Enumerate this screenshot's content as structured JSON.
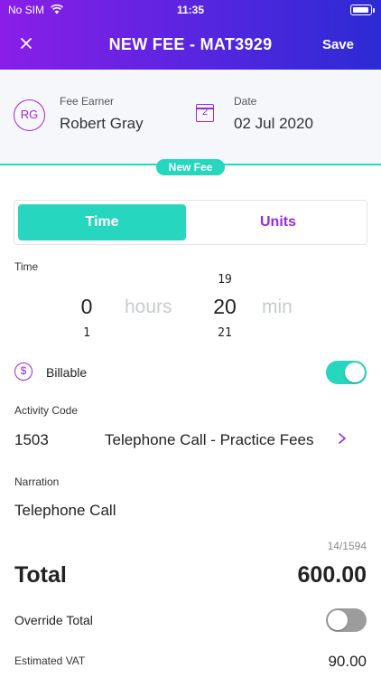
{
  "status_bar": {
    "carrier": "No SIM",
    "time": "11:35"
  },
  "nav": {
    "close_icon": "close-icon",
    "title": "NEW FEE - MAT3929",
    "save_label": "Save"
  },
  "fee_earner": {
    "initials": "RG",
    "label": "Fee Earner",
    "name": "Robert Gray"
  },
  "date": {
    "icon": "calendar-icon",
    "icon_day": "2",
    "label": "Date",
    "value": "02 Jul 2020"
  },
  "badge": {
    "text": "New Fee"
  },
  "segment": {
    "time_label": "Time",
    "units_label": "Units",
    "selected": "Time"
  },
  "time_picker": {
    "label": "Time",
    "hours": {
      "prev": "",
      "value": "0",
      "next": "1",
      "unit": "hours"
    },
    "minutes": {
      "prev": "19",
      "value": "20",
      "next": "21",
      "unit": "min"
    }
  },
  "billable": {
    "icon": "dollar-icon",
    "label": "Billable",
    "on": true
  },
  "activity": {
    "label": "Activity Code",
    "code": "1503",
    "description": "Telephone Call - Practice Fees"
  },
  "narration": {
    "label": "Narration",
    "text": "Telephone Call",
    "counter": "14/1594"
  },
  "total": {
    "label": "Total",
    "value": "600.00"
  },
  "override": {
    "label": "Override Total",
    "on": false
  },
  "vat": {
    "label": "Estimated VAT",
    "value": "90.00"
  },
  "colors": {
    "accent_teal": "#27d6bf",
    "accent_purple": "#9a2ad8",
    "header_start": "#8a1ee8",
    "header_end": "#2b2bd4"
  }
}
